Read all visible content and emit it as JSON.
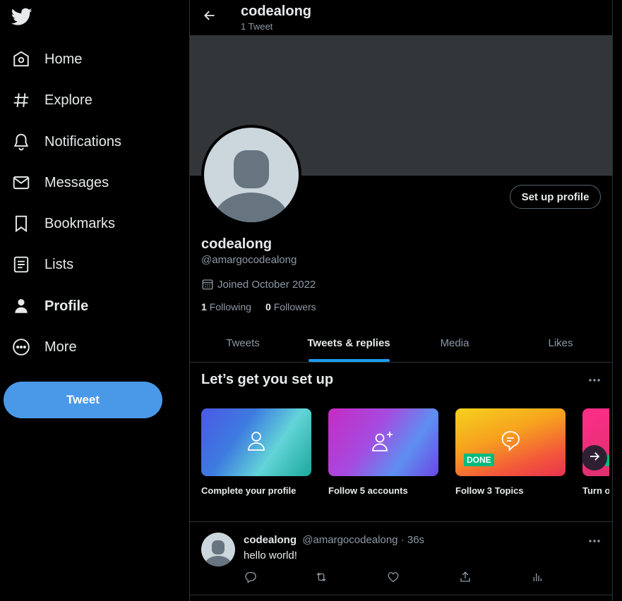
{
  "sidebar": {
    "logo_icon": "twitter-bird-icon",
    "items": [
      {
        "label": "Home",
        "icon": "home-icon"
      },
      {
        "label": "Explore",
        "icon": "hashtag-icon"
      },
      {
        "label": "Notifications",
        "icon": "bell-icon"
      },
      {
        "label": "Messages",
        "icon": "envelope-icon"
      },
      {
        "label": "Bookmarks",
        "icon": "bookmark-icon"
      },
      {
        "label": "Lists",
        "icon": "list-icon"
      },
      {
        "label": "Profile",
        "icon": "person-icon",
        "active": true
      },
      {
        "label": "More",
        "icon": "more-circle-icon"
      }
    ],
    "tweet_button": "Tweet"
  },
  "header": {
    "title": "codealong",
    "subtitle": "1 Tweet"
  },
  "profile": {
    "setup_button": "Set up profile",
    "name": "codealong",
    "handle": "@amargocodealong",
    "joined": "Joined October 2022",
    "following_count": "1",
    "following_label": "Following",
    "followers_count": "0",
    "followers_label": "Followers"
  },
  "tabs": [
    {
      "label": "Tweets"
    },
    {
      "label": "Tweets & replies",
      "active": true
    },
    {
      "label": "Media"
    },
    {
      "label": "Likes"
    }
  ],
  "setup": {
    "title": "Let’s get you set up",
    "cards": [
      {
        "caption": "Complete your profile",
        "icon": "person-outline-icon"
      },
      {
        "caption": "Follow 5 accounts",
        "icon": "person-add-icon"
      },
      {
        "caption": "Follow 3 Topics",
        "icon": "topic-bubble-icon",
        "badge": "DONE"
      },
      {
        "caption": "Turn o",
        "badge": ""
      }
    ]
  },
  "tweet": {
    "name": "codealong",
    "handle": "@amargocodealong",
    "time": "· 36s",
    "text": "hello world!"
  },
  "colors": {
    "accent": "#1d9bf0",
    "tweet_button": "#4a99e9",
    "background": "#000000",
    "banner": "#333639",
    "done_badge": "#00ba7c"
  }
}
